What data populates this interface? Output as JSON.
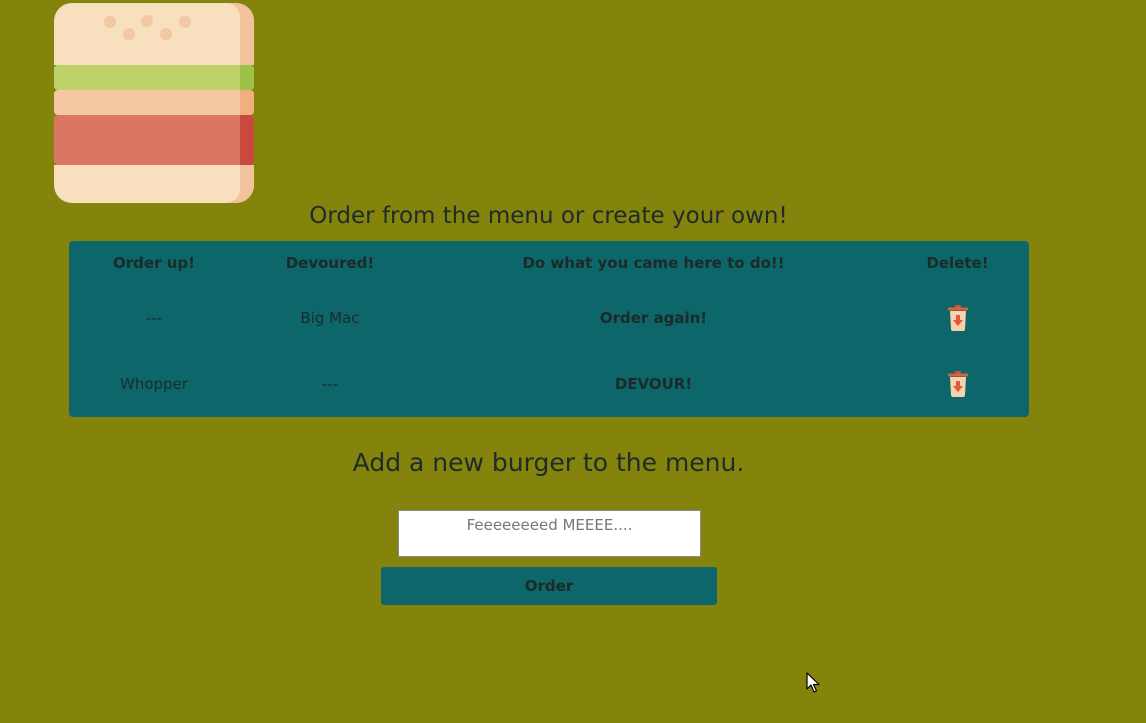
{
  "header": {
    "logo_icon": "burger-icon"
  },
  "page_title": "Order from the menu or create your own!",
  "menu_table": {
    "headers": {
      "order_up": "Order up!",
      "devoured": "Devoured!",
      "action": "Do what you came here to do!!",
      "delete": "Delete!"
    },
    "rows": [
      {
        "order_up": "---",
        "devoured": "Big Mac",
        "action": "Order again!",
        "delete_icon": "trash-icon"
      },
      {
        "order_up": "Whopper",
        "devoured": "---",
        "action": "DEVOUR!",
        "delete_icon": "trash-icon"
      }
    ]
  },
  "form": {
    "title": "Add a new burger to the menu.",
    "input_placeholder": "Feeeeeeeed MEEEE....",
    "input_value": "",
    "submit_label": "Order"
  },
  "colors": {
    "background": "#84840d",
    "panel": "#0d6669",
    "text": "#1f2a2a",
    "trash_accent": "#e05a3a"
  }
}
